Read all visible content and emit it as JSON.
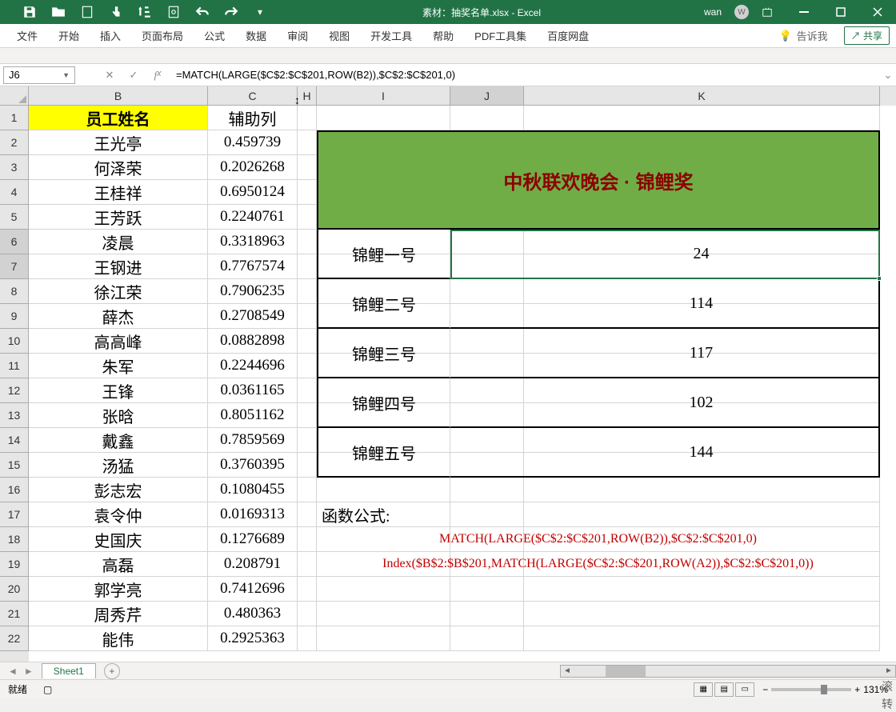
{
  "title": "素材：抽奖名单.xlsx - Excel",
  "user": "wan",
  "avatar_letter": "W",
  "ribbon_tabs": [
    "文件",
    "开始",
    "插入",
    "页面布局",
    "公式",
    "数据",
    "审阅",
    "视图",
    "开发工具",
    "帮助",
    "PDF工具集",
    "百度网盘"
  ],
  "tellme": "告诉我",
  "share": "共享",
  "namebox": "J6",
  "formula": "=MATCH(LARGE($C$2:$C$201,ROW(B2)),$C$2:$C$201,0)",
  "columns": {
    "B": "B",
    "C": "C",
    "H": "H",
    "I": "I",
    "J": "J",
    "K": "K"
  },
  "col_widths": {
    "B": 224,
    "C": 112,
    "H": 24,
    "I": 167,
    "J": 92,
    "K": 445
  },
  "rows": [
    "1",
    "2",
    "3",
    "4",
    "5",
    "6",
    "7",
    "8",
    "9",
    "10",
    "11",
    "12",
    "13",
    "14",
    "15",
    "16",
    "17",
    "18",
    "19",
    "20",
    "21",
    "22"
  ],
  "header_b": "员工姓名",
  "header_c": "辅助列",
  "names": [
    "王光亭",
    "何泽荣",
    "王桂祥",
    "王芳跃",
    "凌晨",
    "王钢进",
    "徐江荣",
    "薛杰",
    "高高峰",
    "朱军",
    "王锋",
    "张晗",
    "戴鑫",
    "汤猛",
    "彭志宏",
    "袁令仲",
    "史国庆",
    "高磊",
    "郭学亮",
    "周秀芹",
    "能伟"
  ],
  "helpers": [
    "0.459739",
    "0.2026268",
    "0.6950124",
    "0.2240761",
    "0.3318963",
    "0.7767574",
    "0.7906235",
    "0.2708549",
    "0.0882898",
    "0.2244696",
    "0.0361165",
    "0.8051162",
    "0.7859569",
    "0.3760395",
    "0.1080455",
    "0.0169313",
    "0.1276689",
    "0.208791",
    "0.7412696",
    "0.480363",
    "0.2925363"
  ],
  "prize_title": "中秋联欢晚会 · 锦鲤奖",
  "prizes": [
    {
      "label": "锦鲤一号",
      "value": "24"
    },
    {
      "label": "锦鲤二号",
      "value": "114"
    },
    {
      "label": "锦鲤三号",
      "value": "117"
    },
    {
      "label": "锦鲤四号",
      "value": "102"
    },
    {
      "label": "锦鲤五号",
      "value": "144"
    }
  ],
  "formula_label": "函数公式:",
  "formula1": "MATCH(LARGE($C$2:$C$201,ROW(B2)),$C$2:$C$201,0)",
  "formula2": "Index($B$2:$B$201,MATCH(LARGE($C$2:$C$201,ROW(A2)),$C$2:$C$201,0))",
  "sheet_name": "Sheet1",
  "status_ready": "就绪",
  "zoom": "131%",
  "edge1": "滚",
  "edge2": "转"
}
